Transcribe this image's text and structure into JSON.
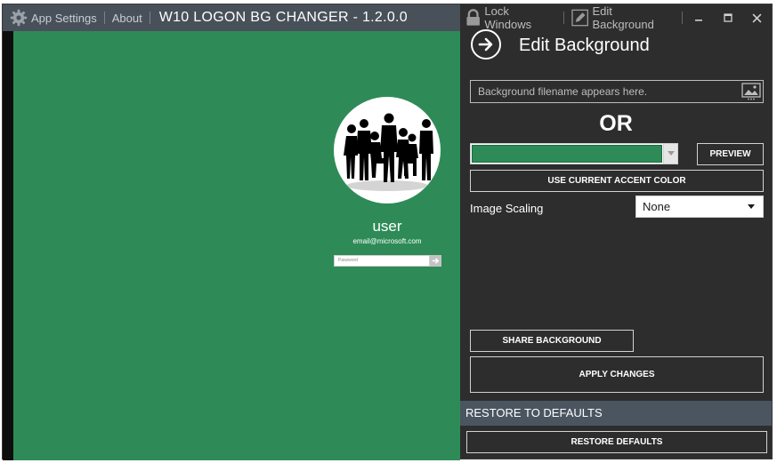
{
  "left_bar": {
    "app_settings": "App Settings",
    "about": "About",
    "app_title": "W10 LOGON BG CHANGER - 1.2.0.0"
  },
  "preview": {
    "background_color": "#2e8b57",
    "user_name": "user",
    "user_email": "email@microsoft.com",
    "password_placeholder": "Password"
  },
  "right_bar": {
    "lock_windows": "Lock Windows",
    "edit_background": "Edit Background"
  },
  "panel": {
    "title": "Edit Background",
    "file_placeholder": "Background filename appears here.",
    "or_label": "OR",
    "selected_color": "#2e8b57",
    "preview_button": "PREVIEW",
    "accent_button": "USE CURRENT ACCENT COLOR",
    "scaling_label": "Image Scaling",
    "scaling_value": "None",
    "share_button": "SHARE BACKGROUND",
    "apply_button": "APPLY CHANGES",
    "restore_header": "RESTORE TO DEFAULTS",
    "restore_button": "RESTORE DEFAULTS"
  },
  "icons": {
    "settings": "gear-icon",
    "lock": "lock-icon",
    "edit": "pencil-icon",
    "back": "arrow-right-circle-icon",
    "image": "image-icon",
    "submit": "arrow-right-icon"
  },
  "colors": {
    "window_bg": "#2d2d2d",
    "title_bar": "#48505a",
    "accent_green": "#2e8b57",
    "section_header": "#4a5560"
  }
}
